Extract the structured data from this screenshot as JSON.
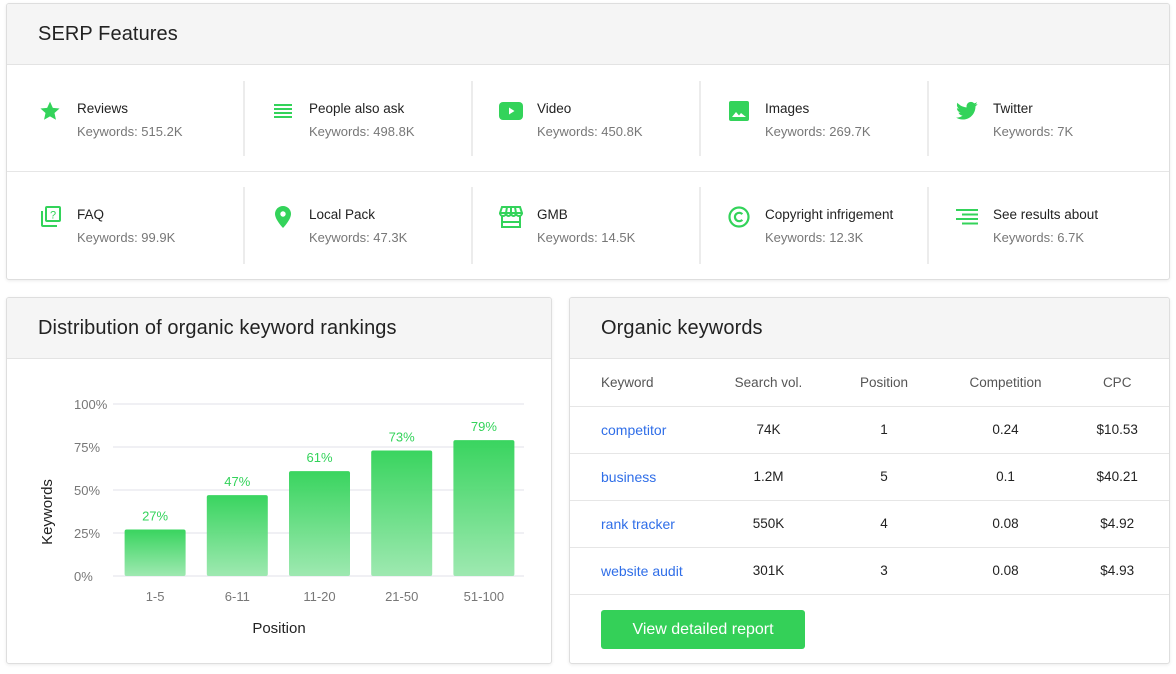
{
  "colors": {
    "accent": "#34d058",
    "link": "#2f6ee8",
    "bar_top": "#33d35a",
    "bar_bottom": "#9be8ae"
  },
  "serp": {
    "title": "SERP Features",
    "rows": [
      [
        {
          "icon": "star-icon",
          "name": "Reviews",
          "count": "Keywords: 515.2K"
        },
        {
          "icon": "list-lines-icon",
          "name": "People also ask",
          "count": "Keywords: 498.8K"
        },
        {
          "icon": "video-play-icon",
          "name": "Video",
          "count": "Keywords: 450.8K"
        },
        {
          "icon": "image-icon",
          "name": "Images",
          "count": "Keywords: 269.7K"
        },
        {
          "icon": "twitter-bird-icon",
          "name": "Twitter",
          "count": "Keywords: 7K"
        }
      ],
      [
        {
          "icon": "faq-question-icon",
          "name": "FAQ",
          "count": "Keywords: 99.9K"
        },
        {
          "icon": "map-pin-icon",
          "name": "Local Pack",
          "count": "Keywords: 47.3K"
        },
        {
          "icon": "storefront-icon",
          "name": "GMB",
          "count": "Keywords: 14.5K"
        },
        {
          "icon": "copyright-icon",
          "name": "Copyright infrigement",
          "count": "Keywords: 12.3K"
        },
        {
          "icon": "align-right-lines-icon",
          "name": "See results about",
          "count": "Keywords: 6.7K"
        }
      ]
    ]
  },
  "distribution": {
    "title": "Distribution of organic keyword rankings"
  },
  "chart_data": {
    "type": "bar",
    "title": "Distribution of organic keyword rankings",
    "xlabel": "Position",
    "ylabel": "Keywords",
    "categories": [
      "1-5",
      "6-11",
      "11-20",
      "21-50",
      "51-100"
    ],
    "values": [
      27,
      47,
      61,
      73,
      79
    ],
    "value_labels": [
      "27%",
      "47%",
      "61%",
      "73%",
      "79%"
    ],
    "ylim": [
      0,
      100
    ],
    "yticks": [
      0,
      25,
      50,
      75,
      100
    ],
    "ytick_labels": [
      "0%",
      "25%",
      "50%",
      "75%",
      "100%"
    ],
    "grid": true,
    "legend": "none"
  },
  "organic": {
    "title": "Organic keywords",
    "columns": [
      "Keyword",
      "Search vol.",
      "Position",
      "Competition",
      "CPC"
    ],
    "rows": [
      {
        "keyword": "competitor",
        "volume": "74K",
        "position": "1",
        "competition": "0.24",
        "cpc": "$10.53"
      },
      {
        "keyword": "business",
        "volume": "1.2M",
        "position": "5",
        "competition": "0.1",
        "cpc": "$40.21"
      },
      {
        "keyword": "rank tracker",
        "volume": "550K",
        "position": "4",
        "competition": "0.08",
        "cpc": "$4.92"
      },
      {
        "keyword": "website audit",
        "volume": "301K",
        "position": "3",
        "competition": "0.08",
        "cpc": "$4.93"
      }
    ],
    "button_label": "View detailed report"
  }
}
